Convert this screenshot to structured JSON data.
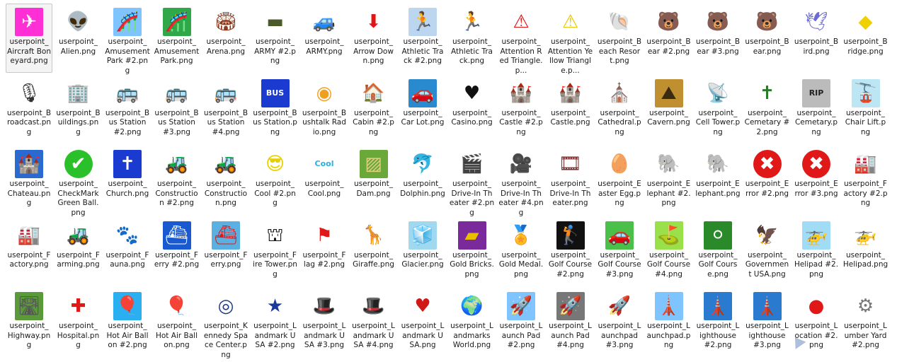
{
  "items": [
    {
      "label": "userpoint_ Aircraft Boneyard.png",
      "icon": "airplane-icon",
      "glyph": "✈",
      "bg": "#ff2fd6",
      "fg": "#ffffff",
      "selected": true
    },
    {
      "label": "userpoint_ Alien.png",
      "icon": "alien-icon",
      "glyph": "👽",
      "bg": "",
      "fg": "#2fbf3b"
    },
    {
      "label": "userpoint_ Amusement Park #2.png",
      "icon": "rollercoaster-icon",
      "glyph": "🎢",
      "bg": "#7fc4ff",
      "fg": "#c03a2b"
    },
    {
      "label": "userpoint_ Amusement Park.png",
      "icon": "rollercoaster-icon",
      "glyph": "🎢",
      "bg": "#2fa84a",
      "fg": "#ffffff"
    },
    {
      "label": "userpoint_ Arena.png",
      "icon": "arena-icon",
      "glyph": "🏟",
      "bg": "",
      "fg": "#8a3b1c"
    },
    {
      "label": "userpoint_ ARMY #2.png",
      "icon": "tank-icon",
      "glyph": "▬",
      "bg": "",
      "fg": "#4a5a2a"
    },
    {
      "label": "userpoint_ ARMY.png",
      "icon": "military-truck-icon",
      "glyph": "🚙",
      "bg": "",
      "fg": "#3d4a25"
    },
    {
      "label": "userpoint_ Arrow Down.png",
      "icon": "arrow-down-icon",
      "glyph": "⬇",
      "bg": "",
      "fg": "#e41414"
    },
    {
      "label": "userpoint_ Athletic Track #2.png",
      "icon": "runner-icon",
      "glyph": "🏃",
      "bg": "#bcd6f0",
      "fg": "#1a1a1a"
    },
    {
      "label": "userpoint_ Athletic Track.png",
      "icon": "runner-icon",
      "glyph": "🏃",
      "bg": "",
      "fg": "#e01818"
    },
    {
      "label": "userpoint_ Attention Red Triangle.p...",
      "icon": "warning-triangle-icon",
      "glyph": "⚠",
      "bg": "",
      "fg": "#e01818"
    },
    {
      "label": "userpoint_ Attention Yellow Triangle.p...",
      "icon": "warning-triangle-icon",
      "glyph": "⚠",
      "bg": "",
      "fg": "#e8c800"
    },
    {
      "label": "userpoint_B each Resort.png",
      "icon": "seashell-icon",
      "glyph": "🐚",
      "bg": "",
      "fg": "#e0803a"
    },
    {
      "label": "userpoint_B ear #2.png",
      "icon": "bear-icon",
      "glyph": "🐻",
      "bg": "",
      "fg": "#1a1a1a"
    },
    {
      "label": "userpoint_B ear #3.png",
      "icon": "bear-icon",
      "glyph": "🐻",
      "bg": "",
      "fg": "#a0301c"
    },
    {
      "label": "userpoint_B ear.png",
      "icon": "bear-face-icon",
      "glyph": "🐻",
      "bg": "",
      "fg": "#8a5a2a"
    },
    {
      "label": "userpoint_B ird.png",
      "icon": "bird-icon",
      "glyph": "🕊",
      "bg": "",
      "fg": "#6a6ad0"
    },
    {
      "label": "userpoint_B ridge.png",
      "icon": "bridge-sign-icon",
      "glyph": "◆",
      "bg": "",
      "fg": "#f0d000"
    },
    {
      "label": "userpoint_B roadcast.png",
      "icon": "microphone-icon",
      "glyph": "🎙",
      "bg": "",
      "fg": "#333333"
    },
    {
      "label": "userpoint_B uildings.png",
      "icon": "buildings-icon",
      "glyph": "🏢",
      "bg": "",
      "fg": "#2a6ad0"
    },
    {
      "label": "userpoint_B us Station #2.png",
      "icon": "bus-icon",
      "glyph": "🚌",
      "bg": "",
      "fg": "#d01818"
    },
    {
      "label": "userpoint_B us Station #3.png",
      "icon": "bus-icon",
      "glyph": "🚌",
      "bg": "",
      "fg": "#1a8a3a"
    },
    {
      "label": "userpoint_B us Station #4.png",
      "icon": "double-decker-bus-icon",
      "glyph": "🚌",
      "bg": "",
      "fg": "#d01818"
    },
    {
      "label": "userpoint_B us Station.png",
      "icon": "bus-sign-icon",
      "glyph": "BUS",
      "bg": "#1a3ad0",
      "fg": "#ffffff"
    },
    {
      "label": "userpoint_B ushtalk Radio.png",
      "icon": "bushtalk-radio-icon",
      "glyph": "◉",
      "bg": "",
      "fg": "#f0a020"
    },
    {
      "label": "userpoint_ Cabin #2.png",
      "icon": "cabin-icon",
      "glyph": "🏠",
      "bg": "",
      "fg": "#a01818"
    },
    {
      "label": "userpoint_ Car Lot.png",
      "icon": "car-icon",
      "glyph": "🚗",
      "bg": "#2a8ad0",
      "fg": "#a0208a"
    },
    {
      "label": "userpoint_ Casino.png",
      "icon": "heart-icon",
      "glyph": "♥",
      "bg": "",
      "fg": "#111111"
    },
    {
      "label": "userpoint_ Castle #2.png",
      "icon": "castle-tower-icon",
      "glyph": "🏰",
      "bg": "",
      "fg": "#a01818"
    },
    {
      "label": "userpoint_ Castle.png",
      "icon": "castle-icon",
      "glyph": "🏰",
      "bg": "",
      "fg": "#7a1010"
    },
    {
      "label": "userpoint_ Cathedral.png",
      "icon": "cathedral-icon",
      "glyph": "⛪",
      "bg": "",
      "fg": "#b03a2a"
    },
    {
      "label": "userpoint_ Cavern.png",
      "icon": "cavern-icon",
      "glyph": "⛰",
      "bg": "#c09030",
      "fg": "#3a2a10"
    },
    {
      "label": "userpoint_ Cell Tower.png",
      "icon": "cell-tower-icon",
      "glyph": "📡",
      "bg": "",
      "fg": "#222222"
    },
    {
      "label": "userpoint_ Cemetary #2.png",
      "icon": "grave-icon",
      "glyph": "✝",
      "bg": "",
      "fg": "#2a7a2a"
    },
    {
      "label": "userpoint_ Cemetary.png",
      "icon": "tombstone-icon",
      "glyph": "RIP",
      "bg": "#bbbbbb",
      "fg": "#222222"
    },
    {
      "label": "userpoint_ Chair Lift.png",
      "icon": "chair-lift-icon",
      "glyph": "🚡",
      "bg": "#bde6f5",
      "fg": "#2a2a2a"
    },
    {
      "label": "userpoint_ Chateau.png",
      "icon": "chateau-icon",
      "glyph": "🏰",
      "bg": "#2a6ad0",
      "fg": "#a01818"
    },
    {
      "label": "userpoint_ CheckMark Green Ball.png",
      "icon": "checkmark-icon",
      "glyph": "✔",
      "bg": "#2ac02a",
      "fg": "#ffffff",
      "round": true
    },
    {
      "label": "userpoint_ Church.png",
      "icon": "church-icon",
      "glyph": "✝",
      "bg": "#1a3ad0",
      "fg": "#ffffff"
    },
    {
      "label": "userpoint_ Construction #2.png",
      "icon": "bulldozer-icon",
      "glyph": "🚜",
      "bg": "",
      "fg": "#e0b000"
    },
    {
      "label": "userpoint_ Construction.png",
      "icon": "bulldozer-icon",
      "glyph": "🚜",
      "bg": "",
      "fg": "#e07000"
    },
    {
      "label": "userpoint_ Cool #2.png",
      "icon": "cool-smiley-icon",
      "glyph": "😎",
      "bg": "",
      "fg": "#e8d000"
    },
    {
      "label": "userpoint_ Cool.png",
      "icon": "cool-text-icon",
      "glyph": "Cool",
      "bg": "",
      "fg": "#2ab0e0"
    },
    {
      "label": "userpoint_ Dam.png",
      "icon": "dam-icon",
      "glyph": "▨",
      "bg": "#6aa83a",
      "fg": "#e0d080"
    },
    {
      "label": "userpoint_ Dolphin.png",
      "icon": "dolphin-icon",
      "glyph": "🐬",
      "bg": "",
      "fg": "#1a7ad0"
    },
    {
      "label": "userpoint_ Drive-In Theater #2.png",
      "icon": "clapperboard-icon",
      "glyph": "🎬",
      "bg": "",
      "fg": "#111111"
    },
    {
      "label": "userpoint_ Drive-In Theater #4.png",
      "icon": "movie-camera-icon",
      "glyph": "🎥",
      "bg": "",
      "fg": "#111111"
    },
    {
      "label": "userpoint_ Drive-In Theater.png",
      "icon": "film-reel-icon",
      "glyph": "🎞",
      "bg": "",
      "fg": "#7a2a2a"
    },
    {
      "label": "userpoint_E aster Egg.png",
      "icon": "easter-egg-icon",
      "glyph": "🥚",
      "bg": "",
      "fg": "#f0b0e0"
    },
    {
      "label": "userpoint_E lephant #2.png",
      "icon": "elephant-icon",
      "glyph": "🐘",
      "bg": "",
      "fg": "#777777"
    },
    {
      "label": "userpoint_E lephant.png",
      "icon": "elephant-icon",
      "glyph": "🐘",
      "bg": "",
      "fg": "#556655"
    },
    {
      "label": "userpoint_E rror #2.png",
      "icon": "error-x-icon",
      "glyph": "✖",
      "bg": "#e01818",
      "fg": "#ffffff",
      "round": true
    },
    {
      "label": "userpoint_E rror #3.png",
      "icon": "error-x-icon",
      "glyph": "✖",
      "bg": "#e01818",
      "fg": "#ffffff",
      "round": true
    },
    {
      "label": "userpoint_F actory #2.png",
      "icon": "factory-icon",
      "glyph": "🏭",
      "bg": "",
      "fg": "#111111"
    },
    {
      "label": "userpoint_F actory.png",
      "icon": "factory-icon",
      "glyph": "🏭",
      "bg": "",
      "fg": "#1a3a8a"
    },
    {
      "label": "userpoint_F arming.png",
      "icon": "tractor-icon",
      "glyph": "🚜",
      "bg": "",
      "fg": "#2a8a2a"
    },
    {
      "label": "userpoint_F auna.png",
      "icon": "paw-print-icon",
      "glyph": "🐾",
      "bg": "",
      "fg": "#111111"
    },
    {
      "label": "userpoint_F erry #2.png",
      "icon": "ferry-sign-icon",
      "glyph": "⛴",
      "bg": "#1a5ad0",
      "fg": "#ffffff"
    },
    {
      "label": "userpoint_F erry.png",
      "icon": "ferry-icon",
      "glyph": "⛴",
      "bg": "#5ab0e0",
      "fg": "#e01818"
    },
    {
      "label": "userpoint_F ire Tower.png",
      "icon": "fire-tower-icon",
      "glyph": "⛫",
      "bg": "",
      "fg": "#111111"
    },
    {
      "label": "userpoint_F lag #2.png",
      "icon": "flag-icon",
      "glyph": "⚑",
      "bg": "",
      "fg": "#e01818"
    },
    {
      "label": "userpoint_ Giraffe.png",
      "icon": "giraffe-icon",
      "glyph": "🦒",
      "bg": "",
      "fg": "#e0a030"
    },
    {
      "label": "userpoint_ Glacier.png",
      "icon": "glacier-icon",
      "glyph": "🧊",
      "bg": "#a0d8f0",
      "fg": "#ffffff"
    },
    {
      "label": "userpoint_ Gold Bricks.png",
      "icon": "gold-bricks-icon",
      "glyph": "▰",
      "bg": "#7a2a9a",
      "fg": "#e8c000"
    },
    {
      "label": "userpoint_ Gold Medal.png",
      "icon": "gold-medal-icon",
      "glyph": "🏅",
      "bg": "",
      "fg": "#e0b000"
    },
    {
      "label": "userpoint_ Golf Course #2.png",
      "icon": "golfer-icon",
      "glyph": "🏌",
      "bg": "#111111",
      "fg": "#ffffff"
    },
    {
      "label": "userpoint_ Golf Course #3.png",
      "icon": "golf-cart-icon",
      "glyph": "🚗",
      "bg": "#4ac04a",
      "fg": "#ffffff"
    },
    {
      "label": "userpoint_ Golf Course #4.png",
      "icon": "golf-flag-icon",
      "glyph": "⛳",
      "bg": "#9ae04a",
      "fg": "#e01818"
    },
    {
      "label": "userpoint_ Golf Course.png",
      "icon": "golf-ball-icon",
      "glyph": "⚪",
      "bg": "#2a8a2a",
      "fg": "#ffffff"
    },
    {
      "label": "userpoint_ Governmen t USA.png",
      "icon": "eagle-icon",
      "glyph": "🦅",
      "bg": "",
      "fg": "#111111"
    },
    {
      "label": "userpoint_ Helipad #2.png",
      "icon": "helicopter-icon",
      "glyph": "🚁",
      "bg": "#a0dcf5",
      "fg": "#e0b000"
    },
    {
      "label": "userpoint_ Helipad.png",
      "icon": "helicopter-icon",
      "glyph": "🚁",
      "bg": "",
      "fg": "#2a2a8a"
    },
    {
      "label": "userpoint_ Highway.png",
      "icon": "highway-icon",
      "glyph": "🛣",
      "bg": "#5a9a3a",
      "fg": "#555555"
    },
    {
      "label": "userpoint_ Hospital.png",
      "icon": "red-cross-icon",
      "glyph": "✚",
      "bg": "",
      "fg": "#e01818"
    },
    {
      "label": "userpoint_ Hot Air Ballon #2.png",
      "icon": "hot-air-balloon-icon",
      "glyph": "🎈",
      "bg": "#2ab0f0",
      "fg": "#e0a000"
    },
    {
      "label": "userpoint_ Hot Air Ballon.png",
      "icon": "hot-air-balloon-icon",
      "glyph": "🎈",
      "bg": "",
      "fg": "#e07020"
    },
    {
      "label": "userpoint_K ennedy Space Center.png",
      "icon": "space-center-seal-icon",
      "glyph": "◎",
      "bg": "",
      "fg": "#1a3a8a"
    },
    {
      "label": "userpoint_L andmark USA #2.png",
      "icon": "star-icon",
      "glyph": "★",
      "bg": "",
      "fg": "#1a3a9a"
    },
    {
      "label": "userpoint_L andmark USA #3.png",
      "icon": "uncle-sam-hat-icon",
      "glyph": "🎩",
      "bg": "",
      "fg": "#e020c0"
    },
    {
      "label": "userpoint_L andmark USA #4.png",
      "icon": "uncle-sam-hat-icon",
      "glyph": "🎩",
      "bg": "",
      "fg": "#1a3a9a"
    },
    {
      "label": "userpoint_L andmark USA.png",
      "icon": "us-flag-heart-icon",
      "glyph": "♥",
      "bg": "",
      "fg": "#d01818"
    },
    {
      "label": "userpoint_L andmarks World.png",
      "icon": "globe-icon",
      "glyph": "🌍",
      "bg": "",
      "fg": "#2a7ad0"
    },
    {
      "label": "userpoint_L aunch Pad #2.png",
      "icon": "rocket-launch-icon",
      "glyph": "🚀",
      "bg": "#7fc4ff",
      "fg": "#ffffff"
    },
    {
      "label": "userpoint_L aunch Pad #4.png",
      "icon": "rocket-launch-icon",
      "glyph": "🚀",
      "bg": "#777777",
      "fg": "#ffffff"
    },
    {
      "label": "userpoint_L aunchpad #3.png",
      "icon": "rocket-icon",
      "glyph": "🚀",
      "bg": "",
      "fg": "#e01818"
    },
    {
      "label": "userpoint_L aunchpad.png",
      "icon": "launch-tower-icon",
      "glyph": "🗼",
      "bg": "#7fc4ff",
      "fg": "#2a4a8a"
    },
    {
      "label": "userpoint_L ighthouse #2.png",
      "icon": "lighthouse-icon",
      "glyph": "🗼",
      "bg": "#2a7ad0",
      "fg": "#e01818"
    },
    {
      "label": "userpoint_L ighthouse #3.png",
      "icon": "lighthouse-icon",
      "glyph": "🗼",
      "bg": "#2a7ad0",
      "fg": "#e01818"
    },
    {
      "label": "userpoint_L ocation #2.png",
      "icon": "red-dot-icon",
      "glyph": "●",
      "bg": "",
      "fg": "#e01818"
    },
    {
      "label": "userpoint_L umber Yard #2.png",
      "icon": "saw-blade-icon",
      "glyph": "⚙",
      "bg": "",
      "fg": "#777777"
    }
  ]
}
